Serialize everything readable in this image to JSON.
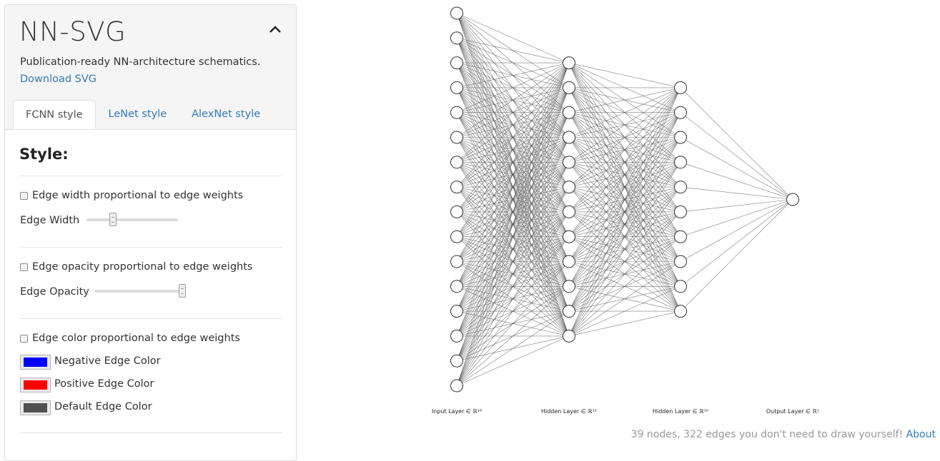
{
  "app": {
    "title": "NN-SVG",
    "tagline": "Publication-ready NN-architecture schematics.",
    "download_label": "Download SVG"
  },
  "tabs": [
    {
      "label": "FCNN style",
      "active": true
    },
    {
      "label": "LeNet style",
      "active": false
    },
    {
      "label": "AlexNet style",
      "active": false
    }
  ],
  "style": {
    "heading": "Style:",
    "edge_width_checkbox": "Edge width proportional to edge weights",
    "edge_width_label": "Edge Width",
    "edge_width_value": 0.27,
    "edge_opacity_checkbox": "Edge opacity proportional to edge weights",
    "edge_opacity_label": "Edge Opacity",
    "edge_opacity_value": 1.0,
    "edge_color_checkbox": "Edge color proportional to edge weights",
    "negative_color_label": "Negative Edge Color",
    "negative_color": "#0000ff",
    "positive_color_label": "Positive Edge Color",
    "positive_color": "#ff0000",
    "default_color_label": "Default Edge Color",
    "default_color": "#505050"
  },
  "network": {
    "layers": [
      {
        "label": "Input Layer ∈ ℝ¹⁶",
        "nodes": 16
      },
      {
        "label": "Hidden Layer ∈ ℝ¹²",
        "nodes": 12
      },
      {
        "label": "Hidden Layer ∈ ℝ¹⁰",
        "nodes": 10
      },
      {
        "label": "Output Layer ∈ ℝ¹",
        "nodes": 1
      }
    ],
    "edge_color": "#505050"
  },
  "footer": {
    "stats": "39 nodes, 322 edges you don't need to draw yourself!",
    "about": "About"
  }
}
